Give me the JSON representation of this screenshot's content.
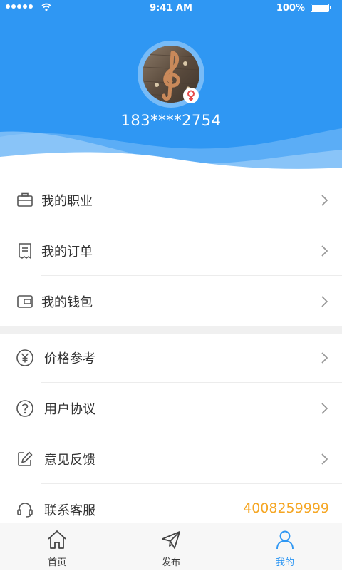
{
  "statusbar": {
    "time": "9:41 AM",
    "battery": "100%"
  },
  "profile": {
    "phone": "183****2754",
    "gender": "female"
  },
  "menu_group1": [
    {
      "label": "我的职业",
      "icon": "briefcase-icon"
    },
    {
      "label": "我的订单",
      "icon": "receipt-icon"
    },
    {
      "label": "我的钱包",
      "icon": "wallet-icon"
    }
  ],
  "menu_group2": [
    {
      "label": "价格参考",
      "icon": "yuan-icon"
    },
    {
      "label": "用户协议",
      "icon": "question-icon"
    },
    {
      "label": "意见反馈",
      "icon": "edit-icon"
    },
    {
      "label": "联系客服",
      "icon": "headset-icon",
      "value": "4008259999"
    }
  ],
  "tabs": [
    {
      "label": "首页",
      "icon": "home-icon",
      "active": false
    },
    {
      "label": "发布",
      "icon": "send-icon",
      "active": false
    },
    {
      "label": "我的",
      "icon": "user-icon",
      "active": true
    }
  ],
  "colors": {
    "primary": "#2f97f3",
    "accent": "#f5a623",
    "gender": "#e64a4a"
  }
}
